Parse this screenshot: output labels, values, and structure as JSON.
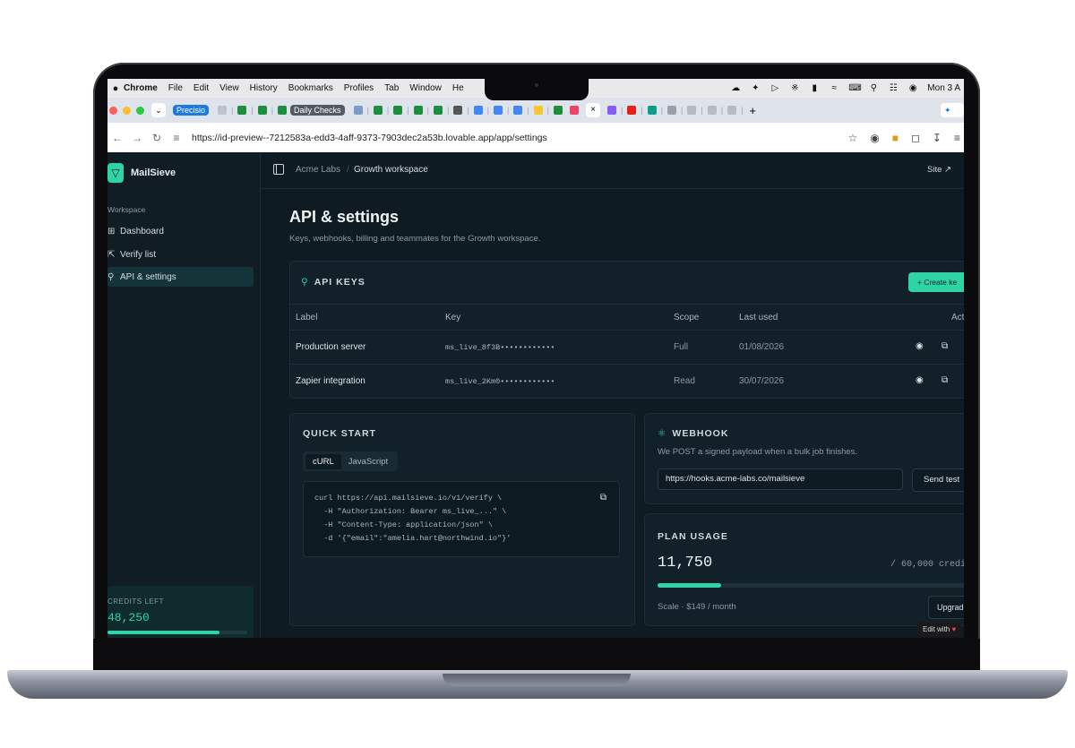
{
  "menubar": {
    "app": "Chrome",
    "items": [
      "File",
      "Edit",
      "View",
      "History",
      "Bookmarks",
      "Profiles",
      "Tab",
      "Window",
      "He"
    ],
    "clock": "Mon 3 A"
  },
  "tabs": {
    "pill1": "Precisio",
    "pill2": "Daily Checks"
  },
  "address": {
    "url": "https://id-preview--7212583a-edd3-4aff-9373-7903dec2a53b.lovable.app/app/settings"
  },
  "sidebar": {
    "brand": "MailSieve",
    "section": "Workspace",
    "items": [
      {
        "label": "Dashboard",
        "icon": "grid-icon"
      },
      {
        "label": "Verify list",
        "icon": "upload-icon"
      },
      {
        "label": "API & settings",
        "icon": "key-icon"
      }
    ],
    "credits_label": "CREDITS LEFT",
    "credits_value": "48,250",
    "credits_fraction": 0.8
  },
  "topbar": {
    "crumb_org": "Acme Labs",
    "crumb_ws": "Growth workspace",
    "site": "Site"
  },
  "page": {
    "title": "API & settings",
    "subtitle": "Keys, webhooks, billing and teammates for the Growth workspace."
  },
  "api_keys": {
    "title": "API KEYS",
    "create_label": "Create ke",
    "columns": [
      "Label",
      "Key",
      "Scope",
      "Last used",
      "Act"
    ],
    "rows": [
      {
        "label": "Production server",
        "key": "ms_live_8f3B••••••••••••",
        "scope": "Full",
        "last_used": "01/08/2026"
      },
      {
        "label": "Zapier integration",
        "key": "ms_live_2Km0••••••••••••",
        "scope": "Read",
        "last_used": "30/07/2026"
      }
    ]
  },
  "quick_start": {
    "title": "QUICK START",
    "tabs": [
      "cURL",
      "JavaScript"
    ],
    "code": [
      "curl https://api.mailsieve.io/v1/verify \\",
      "  -H \"Authorization: Bearer ms_live_...\" \\",
      "  -H \"Content-Type: application/json\" \\",
      "  -d '{\"email\":\"amelia.hart@northwind.io\"}'"
    ]
  },
  "webhook": {
    "title": "WEBHOOK",
    "description": "We POST a signed payload when a bulk job finishes.",
    "url": "https://hooks.acme-labs.co/mailsieve",
    "send_label": "Send test"
  },
  "plan": {
    "title": "PLAN USAGE",
    "used": "11,750",
    "total": "/ 60,000 credi",
    "fraction": 0.196,
    "meta": "Scale · $149 / month",
    "upgrade": "Upgrade"
  },
  "lovable_badge": "Edit with",
  "colors": {
    "accent": "#2fd3a5",
    "background": "#0f1b22",
    "card": "#112029"
  }
}
